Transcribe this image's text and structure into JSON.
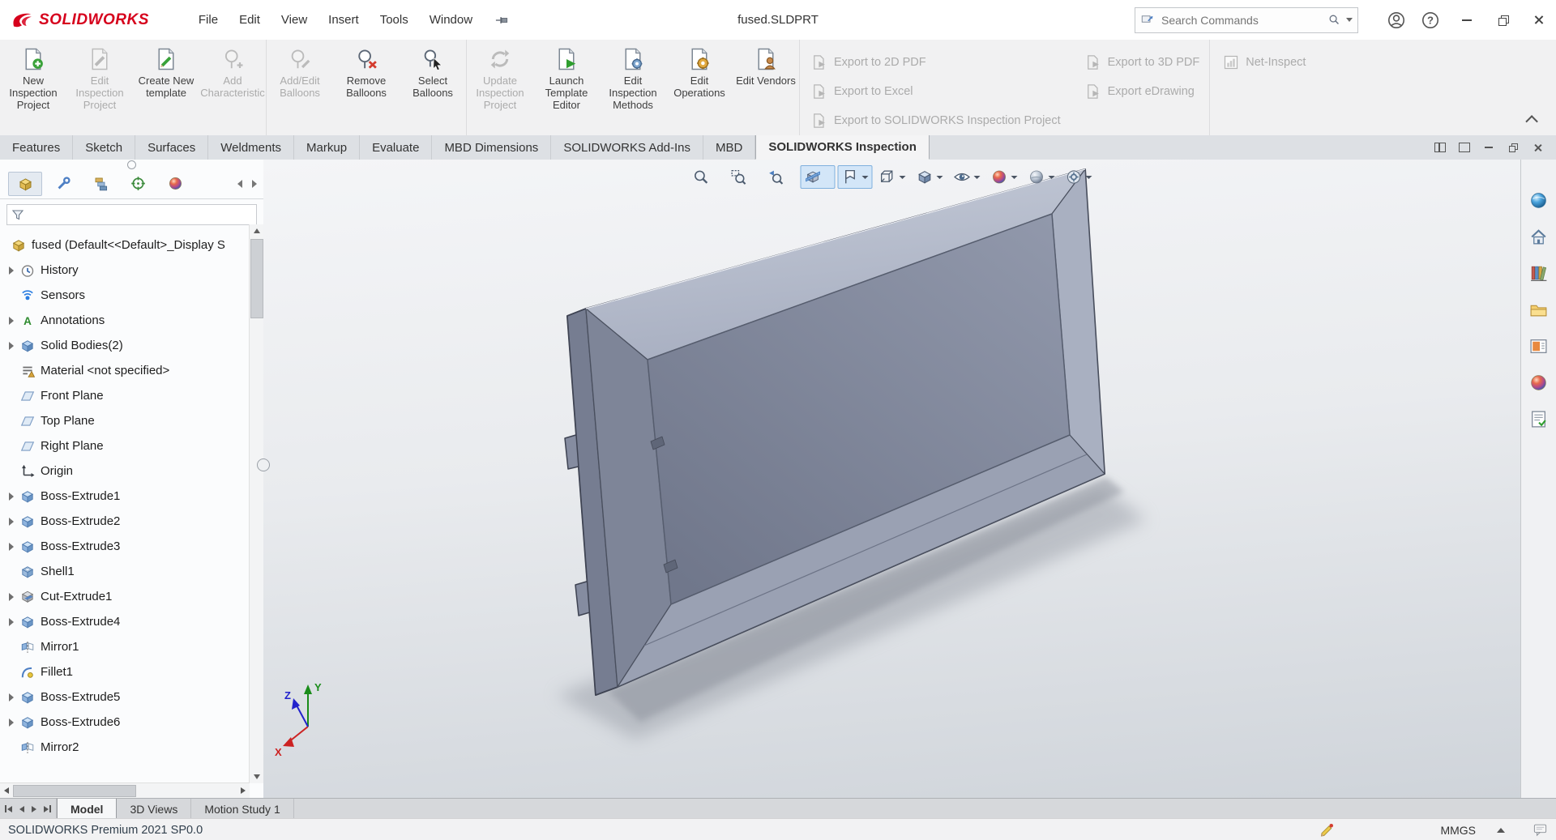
{
  "menubar": {
    "logo_text": "SOLIDWORKS",
    "menus": [
      {
        "label": "File"
      },
      {
        "label": "Edit"
      },
      {
        "label": "View"
      },
      {
        "label": "Insert"
      },
      {
        "label": "Tools"
      },
      {
        "label": "Window"
      }
    ],
    "title": "fused.SLDPRT",
    "search": {
      "placeholder": "Search Commands"
    }
  },
  "ribbon": {
    "buttons": [
      {
        "label": "New Inspection Project",
        "icon": "rb-new"
      },
      {
        "label": "Edit Inspection Project",
        "icon": "rb-editproj",
        "disabled": true
      },
      {
        "label": "Create New template",
        "icon": "rb-newtpl"
      },
      {
        "label": "Add Characteristic",
        "icon": "rb-addchar",
        "disabled": true,
        "divider_after": true
      },
      {
        "label": "Add/Edit Balloons",
        "icon": "rb-addballoon",
        "disabled": true
      },
      {
        "label": "Remove Balloons",
        "icon": "rb-removeballoon"
      },
      {
        "label": "Select Balloons",
        "icon": "rb-selectballoon",
        "divider_after": true
      },
      {
        "label": "Update Inspection Project",
        "icon": "rb-update",
        "disabled": true
      },
      {
        "label": "Launch Template Editor",
        "icon": "rb-launch"
      },
      {
        "label": "Edit Inspection Methods",
        "icon": "rb-methods"
      },
      {
        "label": "Edit Operations",
        "icon": "rb-operations"
      },
      {
        "label": "Edit Vendors",
        "icon": "rb-vendors",
        "divider_after": true
      }
    ],
    "export_col1": [
      {
        "label": "Export to 2D PDF",
        "icon": "rb-export",
        "disabled": true
      },
      {
        "label": "Export to Excel",
        "icon": "rb-export",
        "disabled": true
      },
      {
        "label": "Export to SOLIDWORKS Inspection Project",
        "icon": "rb-export",
        "disabled": true
      }
    ],
    "export_col2": [
      {
        "label": "Export to 3D PDF",
        "icon": "rb-export",
        "disabled": true
      },
      {
        "label": "Export eDrawing",
        "icon": "rb-export",
        "disabled": true
      }
    ],
    "net_inspect": [
      {
        "label": "Net-Inspect",
        "icon": "rb-net",
        "disabled": true
      }
    ]
  },
  "command_tabs": {
    "items": [
      {
        "label": "Features"
      },
      {
        "label": "Sketch"
      },
      {
        "label": "Surfaces"
      },
      {
        "label": "Weldments"
      },
      {
        "label": "Markup"
      },
      {
        "label": "Evaluate"
      },
      {
        "label": "MBD Dimensions"
      },
      {
        "label": "SOLIDWORKS Add-Ins"
      },
      {
        "label": "MBD"
      },
      {
        "label": "SOLIDWORKS Inspection",
        "active": true
      }
    ]
  },
  "feature_panel": {
    "tabs": [
      {
        "name": "featuremanager-tab",
        "icon": "pt-tree",
        "active": true
      },
      {
        "name": "propertymanager-tab",
        "icon": "pt-props"
      },
      {
        "name": "configurationmanager-tab",
        "icon": "pt-config"
      },
      {
        "name": "dimxpertmanager-tab",
        "icon": "pt-dimx"
      },
      {
        "name": "displaymanager-tab",
        "icon": "pt-display"
      }
    ],
    "root": {
      "label": "fused (Default<<Default>_Display S",
      "icon": "part"
    },
    "items": [
      {
        "label": "History",
        "icon": "history",
        "expandable": true
      },
      {
        "label": "Sensors",
        "icon": "sensors"
      },
      {
        "label": "Annotations",
        "icon": "annotations",
        "expandable": true
      },
      {
        "label": "Solid Bodies(2)",
        "icon": "solid-bodies",
        "expandable": true
      },
      {
        "label": "Material <not specified>",
        "icon": "material"
      },
      {
        "label": "Front Plane",
        "icon": "plane"
      },
      {
        "label": "Top Plane",
        "icon": "plane"
      },
      {
        "label": "Right Plane",
        "icon": "plane"
      },
      {
        "label": "Origin",
        "icon": "origin"
      },
      {
        "label": "Boss-Extrude1",
        "icon": "boss-extrude",
        "expandable": true
      },
      {
        "label": "Boss-Extrude2",
        "icon": "boss-extrude",
        "expandable": true
      },
      {
        "label": "Boss-Extrude3",
        "icon": "boss-extrude",
        "expandable": true
      },
      {
        "label": "Shell1",
        "icon": "shell"
      },
      {
        "label": "Cut-Extrude1",
        "icon": "cut-extrude",
        "expandable": true
      },
      {
        "label": "Boss-Extrude4",
        "icon": "boss-extrude",
        "expandable": true
      },
      {
        "label": "Mirror1",
        "icon": "mirror"
      },
      {
        "label": "Fillet1",
        "icon": "fillet"
      },
      {
        "label": "Boss-Extrude5",
        "icon": "boss-extrude",
        "expandable": true
      },
      {
        "label": "Boss-Extrude6",
        "icon": "boss-extrude",
        "expandable": true
      },
      {
        "label": "Mirror2",
        "icon": "mirror"
      }
    ]
  },
  "viewport": {
    "hud": [
      {
        "name": "zoom-to-fit-icon",
        "icon": "hud-zoomfit"
      },
      {
        "name": "zoom-to-area-icon",
        "icon": "hud-zoomarea"
      },
      {
        "name": "previous-view-icon",
        "icon": "hud-prev"
      },
      {
        "name": "section-view-icon",
        "icon": "hud-section",
        "active": true
      },
      {
        "name": "dynamic-annotation-views-icon",
        "icon": "hud-annot",
        "active": true,
        "caret": true
      },
      {
        "name": "view-orientation-icon",
        "icon": "hud-orient",
        "caret": true
      },
      {
        "name": "display-style-icon",
        "icon": "hud-style",
        "caret": true
      },
      {
        "name": "hide-show-items-icon",
        "icon": "hud-hide",
        "caret": true
      },
      {
        "name": "edit-appearance-icon",
        "icon": "hud-appearance",
        "caret": true
      },
      {
        "name": "apply-scene-icon",
        "icon": "hud-scene",
        "caret": true
      },
      {
        "name": "view-settings-icon",
        "icon": "hud-settings",
        "caret": true
      }
    ],
    "triad": {
      "x_label": "X",
      "y_label": "Y",
      "z_label": "Z"
    }
  },
  "task_pane": {
    "icons": [
      {
        "name": "threedexperience-marketplace-icon",
        "icon": "tp-sphere"
      },
      {
        "name": "solidworks-resources-icon",
        "icon": "tp-home"
      },
      {
        "name": "design-library-icon",
        "icon": "tp-library"
      },
      {
        "name": "file-explorer-icon",
        "icon": "tp-folder"
      },
      {
        "name": "view-palette-icon",
        "icon": "tp-palette"
      },
      {
        "name": "appearances-scenes-icon",
        "icon": "tp-appearance"
      },
      {
        "name": "custom-properties-icon",
        "icon": "tp-props"
      }
    ]
  },
  "doc_tabs": {
    "tabs": [
      {
        "label": "Model",
        "active": true
      },
      {
        "label": "3D Views"
      },
      {
        "label": "Motion Study 1"
      }
    ]
  },
  "status_bar": {
    "message": "SOLIDWORKS Premium 2021 SP0.0",
    "units": "MMGS"
  }
}
